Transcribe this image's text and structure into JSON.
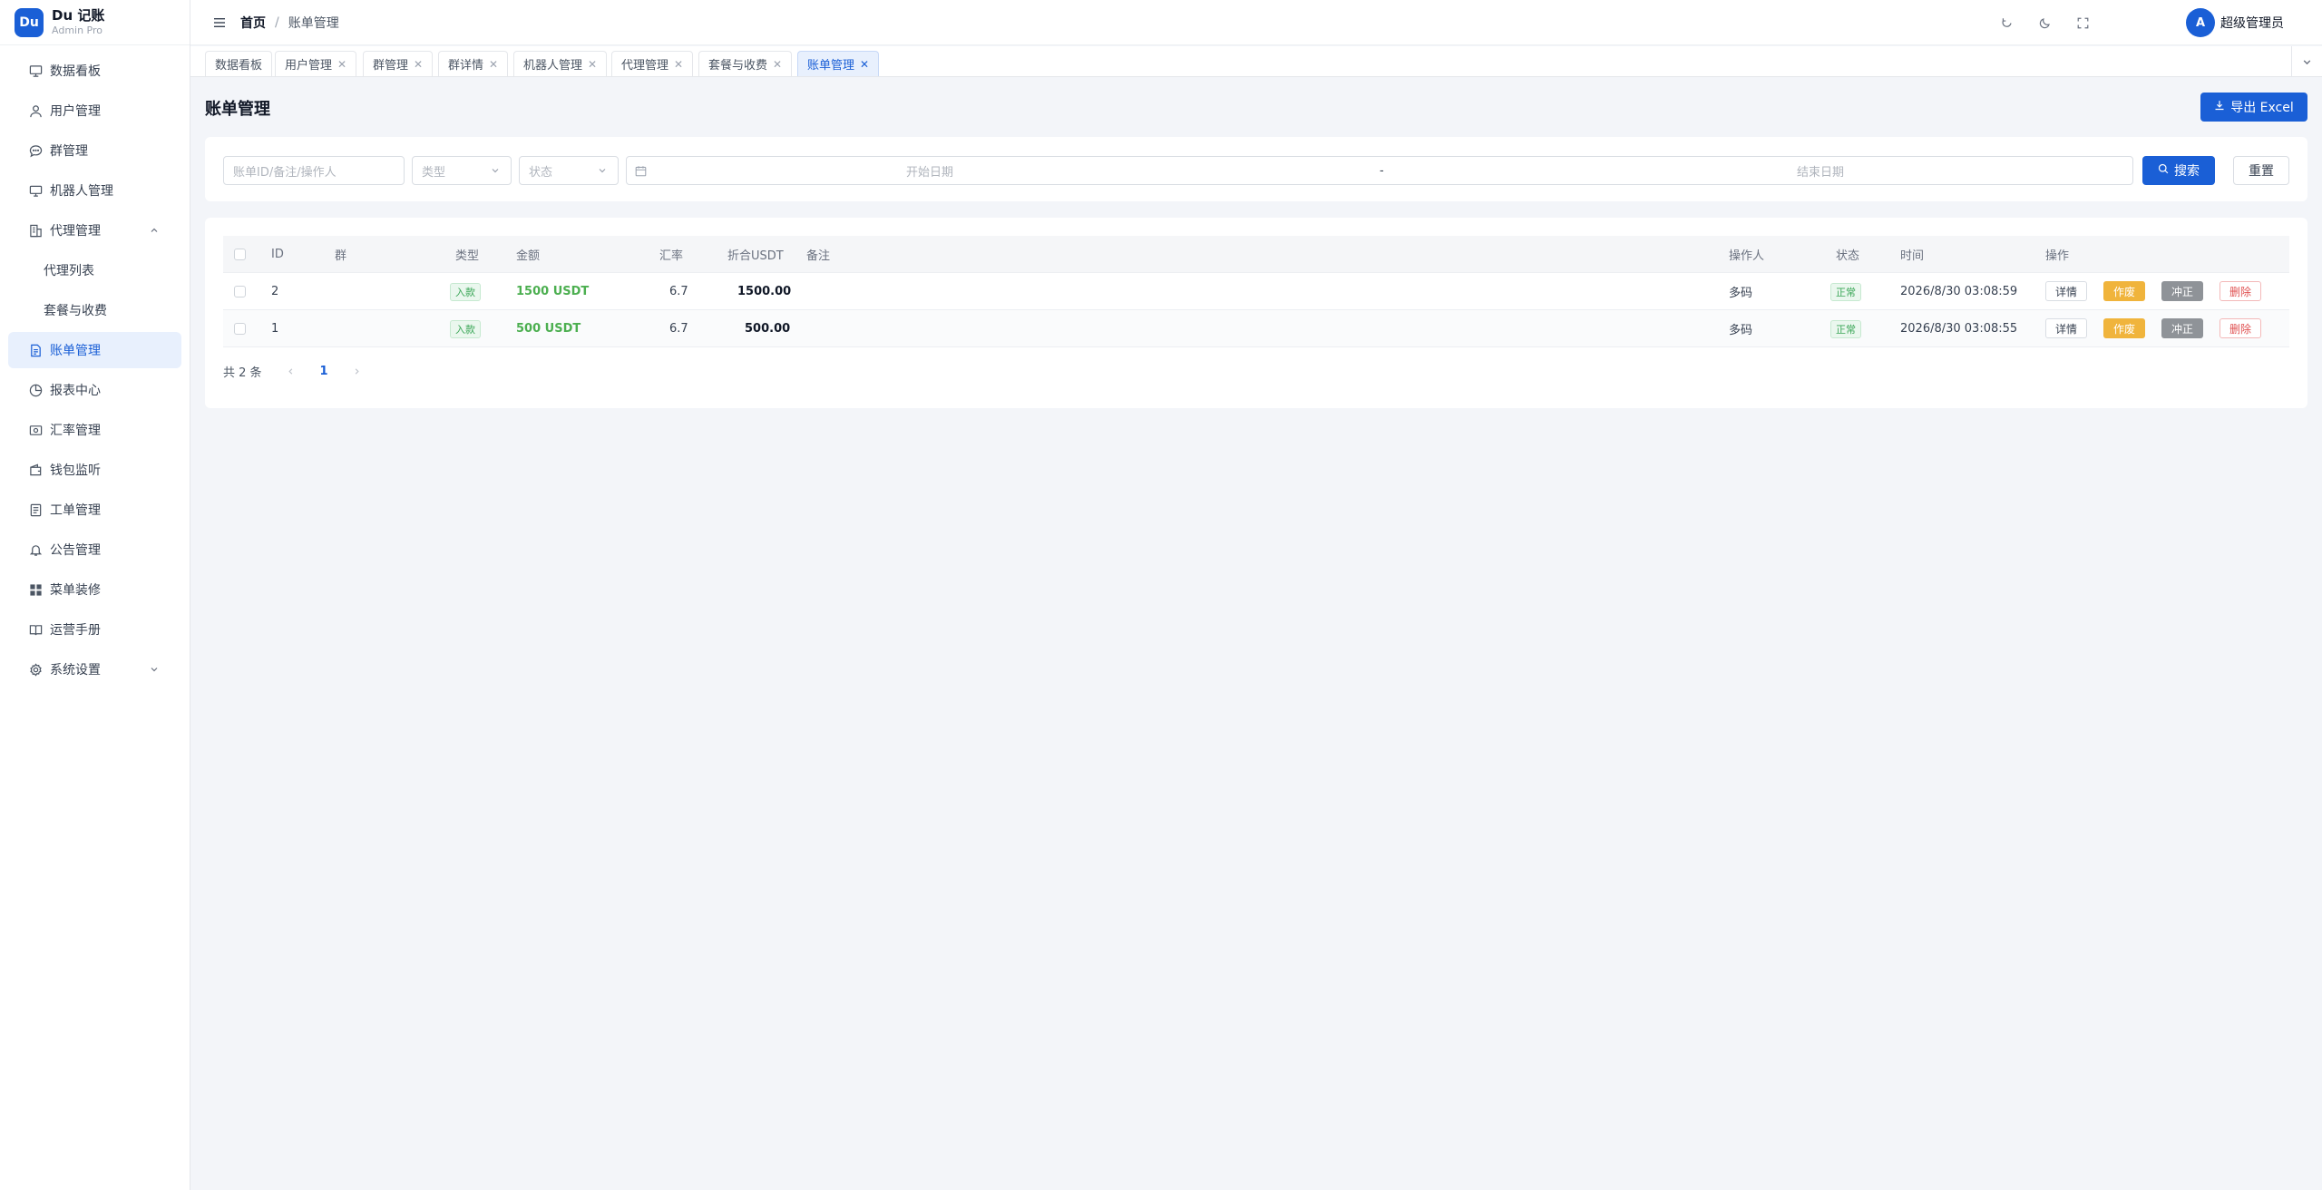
{
  "brand": {
    "logo": "Du",
    "title": "Du 记账",
    "subtitle": "Admin Pro"
  },
  "sidebar": {
    "items": [
      {
        "label": "数据看板",
        "icon": "dashboard-icon"
      },
      {
        "label": "用户管理",
        "icon": "user-icon"
      },
      {
        "label": "群管理",
        "icon": "chat-icon"
      },
      {
        "label": "机器人管理",
        "icon": "monitor-icon"
      },
      {
        "label": "代理管理",
        "icon": "building-icon",
        "expanded": true
      },
      {
        "label": "代理列表",
        "sub": true
      },
      {
        "label": "套餐与收费",
        "sub": true
      },
      {
        "label": "账单管理",
        "icon": "bill-icon",
        "active": true
      },
      {
        "label": "报表中心",
        "icon": "pie-icon"
      },
      {
        "label": "汇率管理",
        "icon": "currency-icon"
      },
      {
        "label": "钱包监听",
        "icon": "wallet-icon"
      },
      {
        "label": "工单管理",
        "icon": "ticket-icon"
      },
      {
        "label": "公告管理",
        "icon": "bell-icon"
      },
      {
        "label": "菜单装修",
        "icon": "grid-icon"
      },
      {
        "label": "运营手册",
        "icon": "book-icon"
      },
      {
        "label": "系统设置",
        "icon": "gear-icon",
        "collapsed": true
      }
    ]
  },
  "header": {
    "breadcrumb": {
      "home": "首页",
      "separator": "/",
      "current": "账单管理"
    },
    "user": {
      "avatar": "A",
      "name": "超级管理员"
    }
  },
  "tabs": [
    {
      "label": "数据看板",
      "closable": false
    },
    {
      "label": "用户管理",
      "closable": true
    },
    {
      "label": "群管理",
      "closable": true
    },
    {
      "label": "群详情",
      "closable": true
    },
    {
      "label": "机器人管理",
      "closable": true
    },
    {
      "label": "代理管理",
      "closable": true
    },
    {
      "label": "套餐与收费",
      "closable": true
    },
    {
      "label": "账单管理",
      "closable": true,
      "active": true
    }
  ],
  "page": {
    "title": "账单管理",
    "export_label": "导出 Excel"
  },
  "filters": {
    "keyword_placeholder": "账单ID/备注/操作人",
    "type_placeholder": "类型",
    "status_placeholder": "状态",
    "start_date_placeholder": "开始日期",
    "range_separator": "-",
    "end_date_placeholder": "结束日期",
    "search_label": "搜索",
    "reset_label": "重置"
  },
  "table": {
    "columns": {
      "id": "ID",
      "group": "群",
      "type": "类型",
      "amount": "金额",
      "rate": "汇率",
      "usdt": "折合USDT",
      "note": "备注",
      "operator": "操作人",
      "status": "状态",
      "time": "时间",
      "actions": "操作"
    },
    "rows": [
      {
        "id": "2",
        "group": "",
        "type": "入款",
        "amount": "1500 USDT",
        "rate": "6.7",
        "usdt": "1500.00",
        "note": "",
        "operator": "多码",
        "status": "正常",
        "time": "2026/8/30 03:08:59"
      },
      {
        "id": "1",
        "group": "",
        "type": "入款",
        "amount": "500 USDT",
        "rate": "6.7",
        "usdt": "500.00",
        "note": "",
        "operator": "多码",
        "status": "正常",
        "time": "2026/8/30 03:08:55"
      }
    ],
    "action_labels": {
      "detail": "详情",
      "void": "作废",
      "reverse": "冲正",
      "delete": "删除"
    }
  },
  "pagination": {
    "total_text": "共 2 条",
    "current_page": "1"
  },
  "colors": {
    "primary": "#1a5fd6",
    "amount_green": "#4caf50",
    "void_orange": "#f0b43c",
    "reverse_gray": "#8f9398",
    "delete_red": "#e05252"
  }
}
